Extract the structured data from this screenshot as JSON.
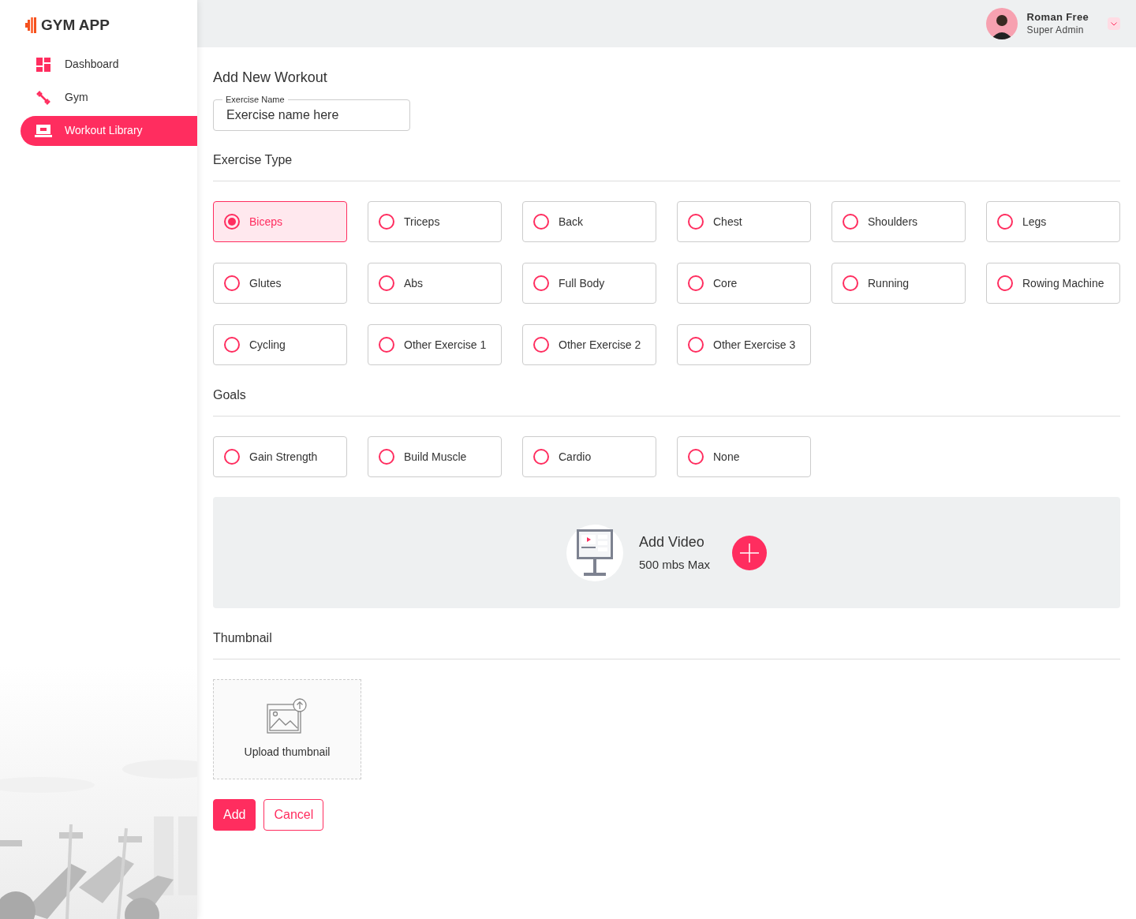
{
  "sidebar": {
    "logo": "GYM APP",
    "items": [
      {
        "label": "Dashboard",
        "selected": false
      },
      {
        "label": "Gym",
        "selected": false
      },
      {
        "label": "Workout Library",
        "selected": true
      }
    ]
  },
  "header": {
    "user": {
      "name": "Roman Free",
      "role": "Super Admin"
    }
  },
  "form": {
    "title": "Add New Workout",
    "exercise_name": {
      "label": "Exercise Name",
      "value": "Exercise name here"
    },
    "exercise_type": {
      "title": "Exercise Type",
      "options": [
        {
          "label": "Biceps",
          "selected": true
        },
        {
          "label": "Triceps",
          "selected": false
        },
        {
          "label": "Back",
          "selected": false
        },
        {
          "label": "Chest",
          "selected": false
        },
        {
          "label": "Shoulders",
          "selected": false
        },
        {
          "label": "Legs",
          "selected": false
        },
        {
          "label": "Glutes",
          "selected": false
        },
        {
          "label": "Abs",
          "selected": false
        },
        {
          "label": "Full Body",
          "selected": false
        },
        {
          "label": "Core",
          "selected": false
        },
        {
          "label": "Running",
          "selected": false
        },
        {
          "label": "Rowing Machine",
          "selected": false
        },
        {
          "label": "Cycling",
          "selected": false
        },
        {
          "label": "Other Exercise 1",
          "selected": false
        },
        {
          "label": "Other Exercise 2",
          "selected": false
        },
        {
          "label": "Other Exercise 3",
          "selected": false
        }
      ]
    },
    "goals": {
      "title": "Goals",
      "options": [
        {
          "label": "Gain Strength",
          "selected": false
        },
        {
          "label": "Build Muscle",
          "selected": false
        },
        {
          "label": "Cardio",
          "selected": false
        },
        {
          "label": "None",
          "selected": false
        }
      ]
    },
    "video": {
      "title": "Add Video",
      "limit": "500 mbs Max"
    },
    "thumbnail": {
      "title": "Thumbnail",
      "upload_label": "Upload thumbnail"
    },
    "buttons": [
      {
        "label": "Add",
        "kind": "primary"
      },
      {
        "label": "Cancel",
        "kind": "secondary"
      }
    ]
  }
}
